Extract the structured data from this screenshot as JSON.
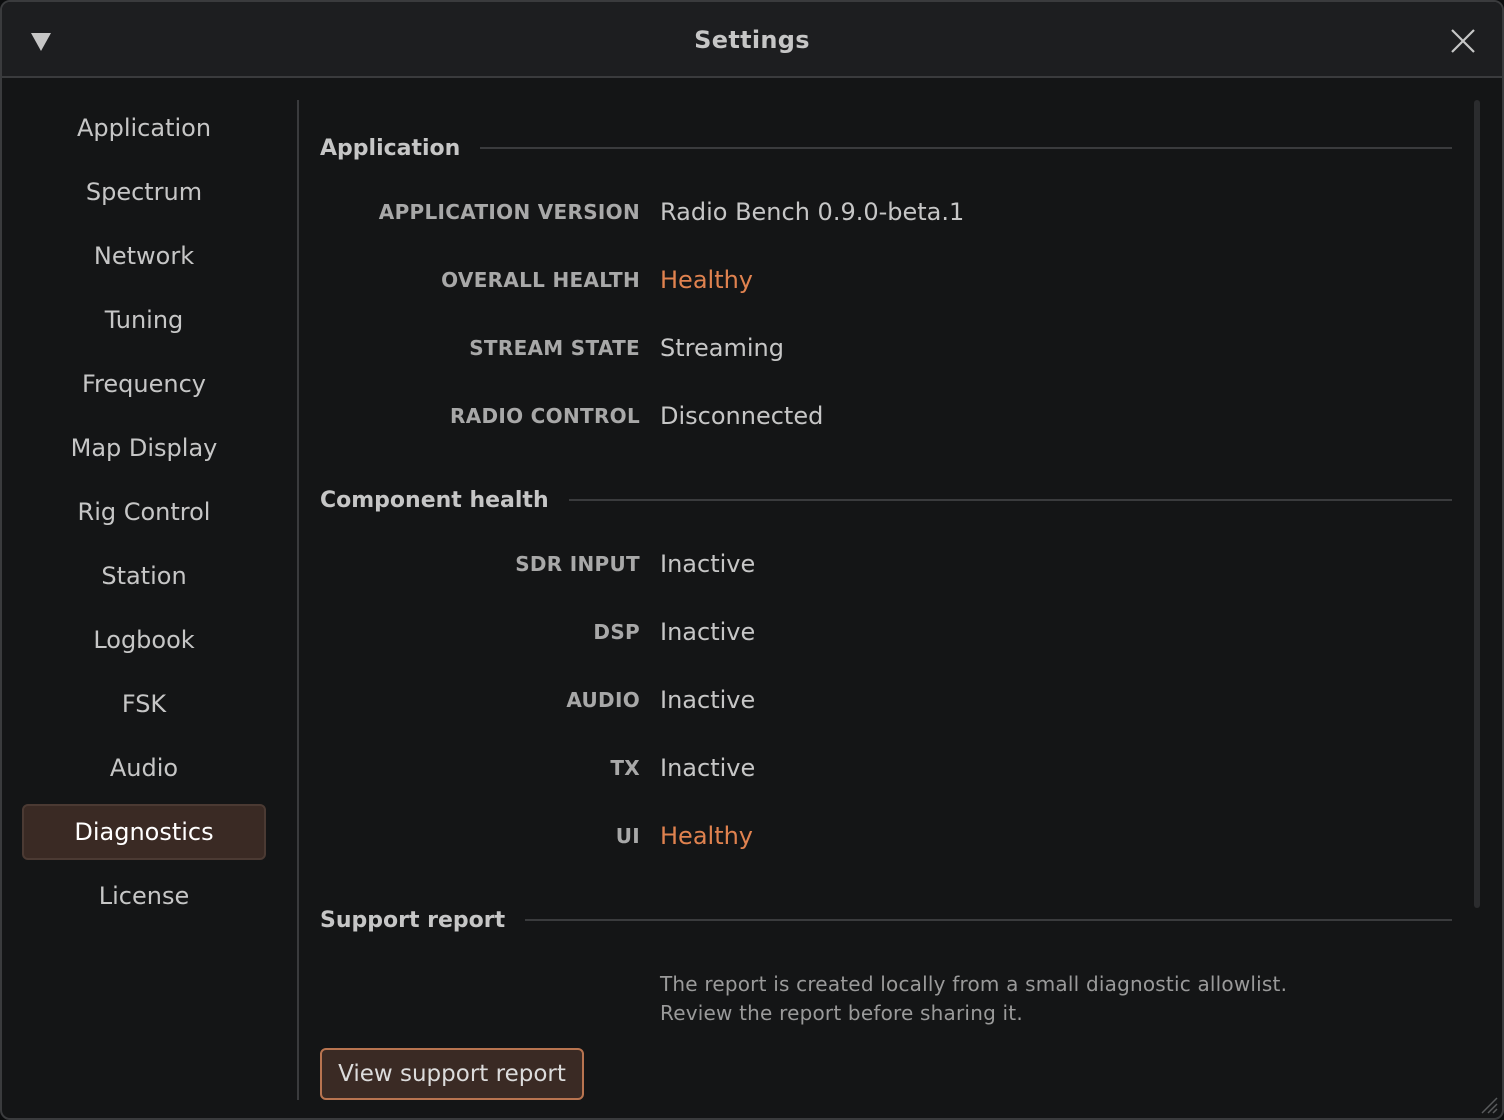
{
  "window": {
    "title": "Settings"
  },
  "sidebar": {
    "items": [
      {
        "label": "Application"
      },
      {
        "label": "Spectrum"
      },
      {
        "label": "Network"
      },
      {
        "label": "Tuning"
      },
      {
        "label": "Frequency"
      },
      {
        "label": "Map Display"
      },
      {
        "label": "Rig Control"
      },
      {
        "label": "Station"
      },
      {
        "label": "Logbook"
      },
      {
        "label": "FSK"
      },
      {
        "label": "Audio"
      },
      {
        "label": "Diagnostics"
      },
      {
        "label": "License"
      }
    ],
    "selected": "Diagnostics"
  },
  "sections": {
    "application": {
      "title": "Application",
      "rows": [
        {
          "key": "APPLICATION VERSION",
          "value": "Radio Bench 0.9.0-beta.1"
        },
        {
          "key": "OVERALL HEALTH",
          "value": "Healthy"
        },
        {
          "key": "STREAM STATE",
          "value": "Streaming"
        },
        {
          "key": "RADIO CONTROL",
          "value": "Disconnected"
        }
      ]
    },
    "components": {
      "title": "Component health",
      "rows": [
        {
          "key": "SDR INPUT",
          "value": "Inactive"
        },
        {
          "key": "DSP",
          "value": "Inactive"
        },
        {
          "key": "AUDIO",
          "value": "Inactive"
        },
        {
          "key": "TX",
          "value": "Inactive"
        },
        {
          "key": "UI",
          "value": "Healthy"
        }
      ]
    },
    "support": {
      "title": "Support report",
      "note_line1": "The report is created locally from a small diagnostic allowlist.",
      "note_line2": "Review the report before sharing it.",
      "button_label": "View support report"
    }
  },
  "colors": {
    "accent": "#e0824f",
    "selected_bg": "#3a2a24",
    "button_border": "#b87450"
  },
  "icons": {
    "menu": "triangle-down-icon",
    "close": "close-icon",
    "resize": "resize-grip-icon"
  }
}
